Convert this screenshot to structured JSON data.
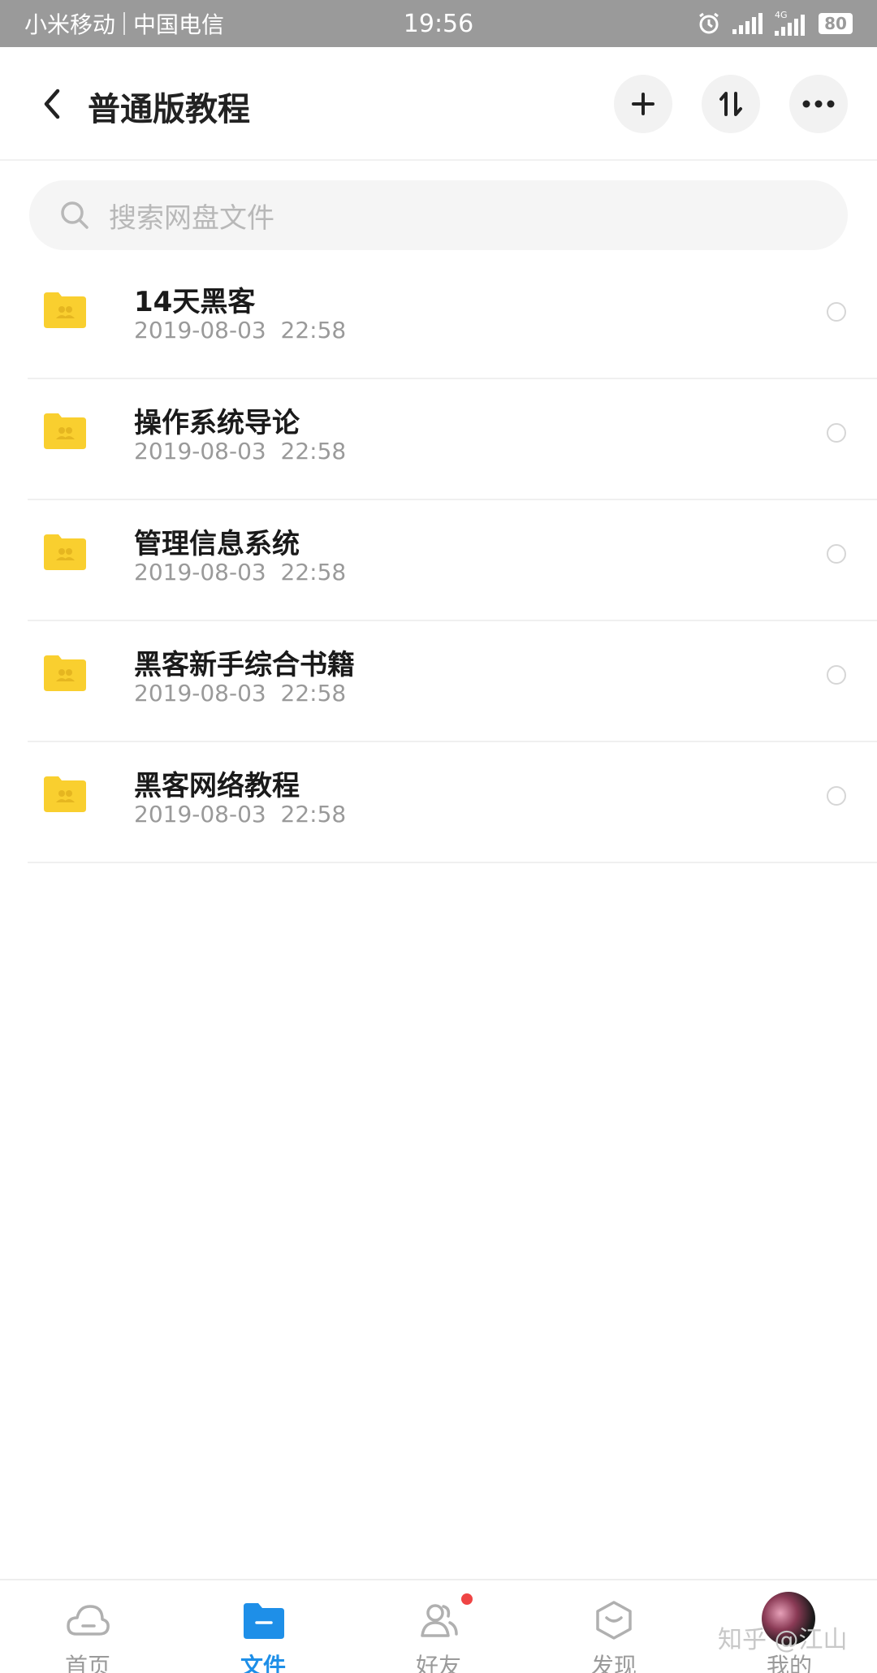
{
  "status_bar": {
    "carrier1": "小米移动",
    "carrier2": "中国电信",
    "time": "19:56",
    "network": "4G",
    "battery": "80",
    "icons": [
      "alarm-icon",
      "signal-icon",
      "signal-4g-icon",
      "battery-icon"
    ]
  },
  "header": {
    "title": "普通版教程",
    "icons": [
      "back-icon",
      "add-icon",
      "sort-icon",
      "more-icon"
    ]
  },
  "search": {
    "placeholder": "搜索网盘文件"
  },
  "files": [
    {
      "name": "14天黑客",
      "date": "2019-08-03  22:58"
    },
    {
      "name": "操作系统导论",
      "date": "2019-08-03  22:58"
    },
    {
      "name": "管理信息系统",
      "date": "2019-08-03  22:58"
    },
    {
      "name": "黑客新手综合书籍",
      "date": "2019-08-03  22:58"
    },
    {
      "name": "黑客网络教程",
      "date": "2019-08-03  22:58"
    }
  ],
  "bottom_nav": {
    "items": [
      {
        "label": "首页",
        "icon": "cloud-icon"
      },
      {
        "label": "文件",
        "icon": "folder-icon",
        "active": true
      },
      {
        "label": "好友",
        "icon": "friends-icon"
      },
      {
        "label": "发现",
        "icon": "discover-icon"
      },
      {
        "label": "我的",
        "icon": "avatar"
      }
    ]
  },
  "watermark": "知乎 @江山",
  "colors": {
    "accent": "#1e8fe8",
    "folder": "#f9cf2f",
    "badge": "#ef4444"
  }
}
